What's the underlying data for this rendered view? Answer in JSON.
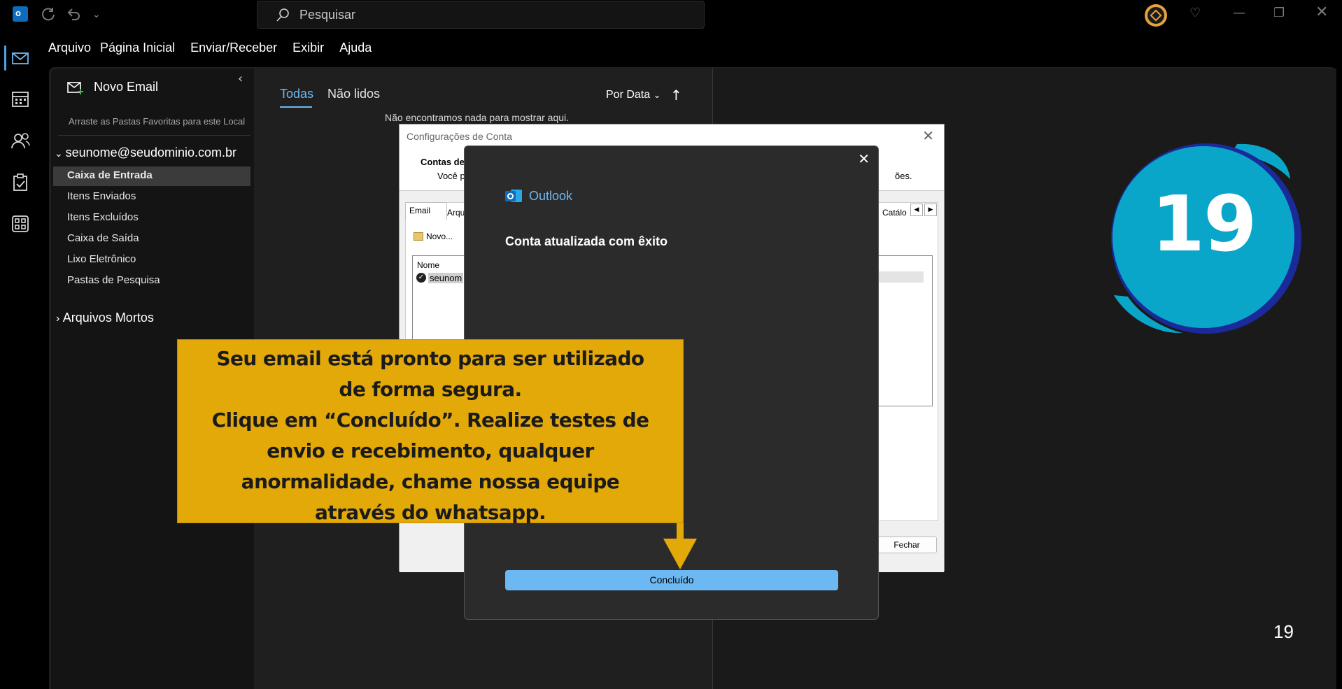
{
  "titlebar": {
    "search_placeholder": "Pesquisar"
  },
  "menu": [
    "Arquivo",
    "Página Inicial",
    "Enviar/Receber",
    "Exibir",
    "Ajuda"
  ],
  "folder_pane": {
    "new_mail": "Novo Email",
    "favorites_hint": "Arraste as Pastas Favoritas para este Local",
    "account": "seunome@seudominio.com.br",
    "folders": [
      "Caixa de Entrada",
      "Itens Enviados",
      "Itens Excluídos",
      "Caixa de Saída",
      "Lixo Eletrônico",
      "Pastas de Pesquisa"
    ],
    "archive": "Arquivos Mortos"
  },
  "message_list": {
    "tab_all": "Todas",
    "tab_unread": "Não lidos",
    "sort_label": "Por Data",
    "empty_text": "Não encontramos nada para mostrar aqui."
  },
  "account_settings": {
    "title": "Configurações de Conta",
    "header_title": "Contas de",
    "header_prefix": "Você p",
    "header_suffix": "ões.",
    "tab_email": "Email",
    "tab_files": "Arqu",
    "tab_catalog": "Catálo",
    "new_button": "Novo...",
    "col_name": "Nome",
    "account_row": "seunom",
    "close_button": "Fechar"
  },
  "success_dialog": {
    "brand": "Outlook",
    "message": "Conta atualizada com êxito",
    "done_button": "Concluído"
  },
  "callout": {
    "lines": [
      "Seu email está pronto para ser utilizado",
      "de forma segura.",
      "Clique em “Concluído”.  Realize testes de",
      "envio e recebimento, qualquer",
      "anormalidade, chame nossa equipe",
      "através do whatsapp."
    ]
  },
  "step_badge": "19",
  "page_number": "19",
  "colors": {
    "accent": "#6cb8f2",
    "callout": "#e3a908",
    "badge": "#0aa6c9",
    "badge_ring": "#1a2a9a"
  }
}
